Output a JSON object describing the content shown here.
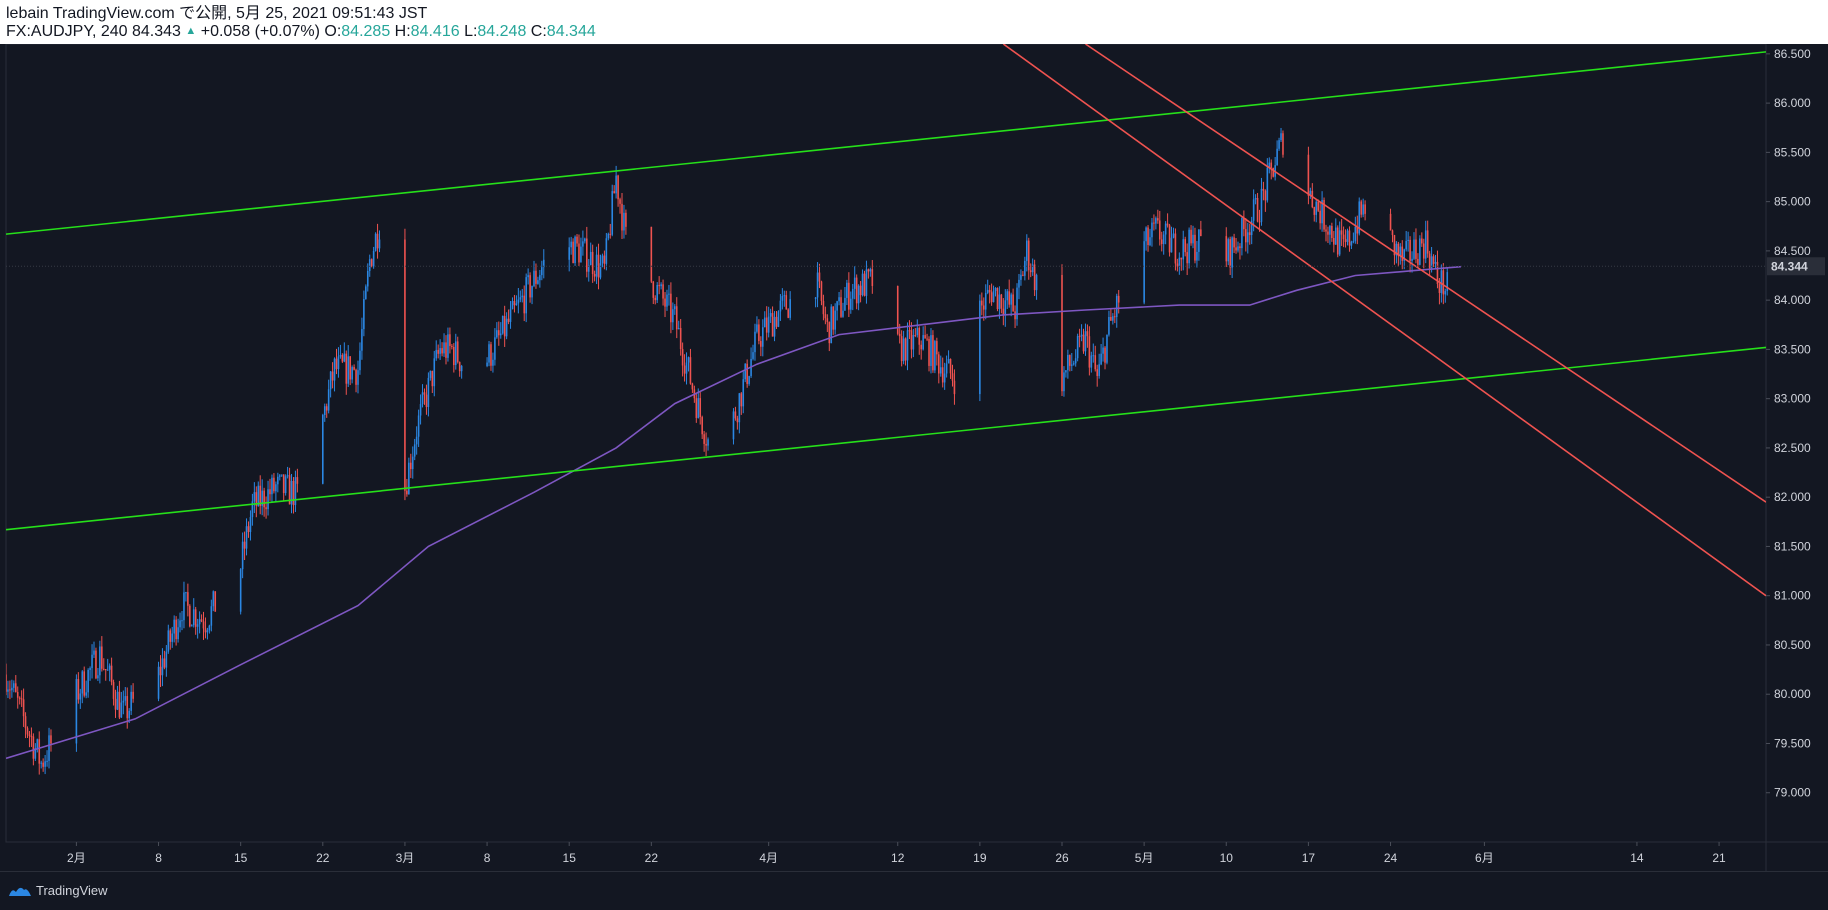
{
  "header": {
    "publisher_line": "lebain TradingView.com で公開, 5月 25, 2021 09:51:43 JST",
    "symbol": "FX:AUDJPY, 240",
    "last": "84.343",
    "change": "+0.058 (+0.07%)",
    "open_label": "O:",
    "open": "84.285",
    "high_label": "H:",
    "high": "84.416",
    "low_label": "L:",
    "low": "84.248",
    "close_label": "C:",
    "close": "84.344"
  },
  "footer": {
    "brand": "TradingView"
  },
  "colors": {
    "background": "#131722",
    "up_candle": "#2b87e3",
    "down_candle": "#ef5350",
    "ma_line": "#7e57c2",
    "channel_green": "#26e01a",
    "channel_red": "#ef5350",
    "price_badge": "#2a2e39"
  },
  "chart_data": {
    "type": "candlestick",
    "symbol": "FX:AUDJPY",
    "interval": "240",
    "ylim": [
      78.5,
      86.6
    ],
    "y_ticks": [
      "79.000",
      "79.500",
      "80.000",
      "80.500",
      "81.000",
      "81.500",
      "82.000",
      "82.500",
      "83.000",
      "83.500",
      "84.000",
      "84.500",
      "85.000",
      "85.500",
      "86.000",
      "86.500"
    ],
    "x_ticks": [
      "2月",
      "8",
      "15",
      "22",
      "3月",
      "8",
      "15",
      "22",
      "4月",
      "12",
      "19",
      "26",
      "5月",
      "10",
      "17",
      "24",
      "6月",
      "14",
      "21"
    ],
    "current_price": "84.344",
    "close_path": [
      {
        "date": "2021-01-26",
        "price": 80.2
      },
      {
        "date": "2021-01-29",
        "price": 79.3
      },
      {
        "date": "2021-02-01",
        "price": 80.0
      },
      {
        "date": "2021-02-03",
        "price": 80.4
      },
      {
        "date": "2021-02-05",
        "price": 79.8
      },
      {
        "date": "2021-02-08",
        "price": 80.2
      },
      {
        "date": "2021-02-10",
        "price": 80.9
      },
      {
        "date": "2021-02-12",
        "price": 80.75
      },
      {
        "date": "2021-02-15",
        "price": 81.3
      },
      {
        "date": "2021-02-16",
        "price": 81.9
      },
      {
        "date": "2021-02-18",
        "price": 82.1
      },
      {
        "date": "2021-02-21",
        "price": 82.0
      },
      {
        "date": "2021-02-22",
        "price": 82.8
      },
      {
        "date": "2021-02-23",
        "price": 83.3
      },
      {
        "date": "2021-02-25",
        "price": 83.3
      },
      {
        "date": "2021-02-26",
        "price": 84.4
      },
      {
        "date": "2021-02-27",
        "price": 84.85
      },
      {
        "date": "2021-02-28",
        "price": 83.2
      },
      {
        "date": "2021-03-01",
        "price": 82.1
      },
      {
        "date": "2021-03-02",
        "price": 82.7
      },
      {
        "date": "2021-03-04",
        "price": 83.5
      },
      {
        "date": "2021-03-05",
        "price": 83.5
      },
      {
        "date": "2021-03-07",
        "price": 83.2
      },
      {
        "date": "2021-03-09",
        "price": 83.6
      },
      {
        "date": "2021-03-11",
        "price": 84.0
      },
      {
        "date": "2021-03-14",
        "price": 84.6
      },
      {
        "date": "2021-03-16",
        "price": 84.5
      },
      {
        "date": "2021-03-18",
        "price": 84.3
      },
      {
        "date": "2021-03-19",
        "price": 85.25
      },
      {
        "date": "2021-03-20",
        "price": 84.5
      },
      {
        "date": "2021-03-22",
        "price": 84.2
      },
      {
        "date": "2021-03-24",
        "price": 83.8
      },
      {
        "date": "2021-03-26",
        "price": 82.9
      },
      {
        "date": "2021-03-27",
        "price": 82.5
      },
      {
        "date": "2021-03-29",
        "price": 82.8
      },
      {
        "date": "2021-03-31",
        "price": 83.6
      },
      {
        "date": "2021-04-02",
        "price": 83.9
      },
      {
        "date": "2021-04-05",
        "price": 84.2
      },
      {
        "date": "2021-04-06",
        "price": 83.7
      },
      {
        "date": "2021-04-08",
        "price": 84.1
      },
      {
        "date": "2021-04-10",
        "price": 84.2
      },
      {
        "date": "2021-04-12",
        "price": 83.5
      },
      {
        "date": "2021-04-14",
        "price": 83.6
      },
      {
        "date": "2021-04-16",
        "price": 83.3
      },
      {
        "date": "2021-04-18",
        "price": 83.1
      },
      {
        "date": "2021-04-19",
        "price": 83.9
      },
      {
        "date": "2021-04-20",
        "price": 84.1
      },
      {
        "date": "2021-04-22",
        "price": 83.9
      },
      {
        "date": "2021-04-23",
        "price": 84.5
      },
      {
        "date": "2021-04-25",
        "price": 83.7
      },
      {
        "date": "2021-04-26",
        "price": 83.2
      },
      {
        "date": "2021-04-28",
        "price": 83.6
      },
      {
        "date": "2021-04-29",
        "price": 83.2
      },
      {
        "date": "2021-04-30",
        "price": 83.7
      },
      {
        "date": "2021-05-02",
        "price": 84.4
      },
      {
        "date": "2021-05-04",
        "price": 84.7
      },
      {
        "date": "2021-05-06",
        "price": 84.5
      },
      {
        "date": "2021-05-08",
        "price": 84.6
      },
      {
        "date": "2021-05-09",
        "price": 84.3
      },
      {
        "date": "2021-05-11",
        "price": 84.6
      },
      {
        "date": "2021-05-13",
        "price": 85.0
      },
      {
        "date": "2021-05-15",
        "price": 85.7
      },
      {
        "date": "2021-05-16",
        "price": 85.3
      },
      {
        "date": "2021-05-18",
        "price": 84.9
      },
      {
        "date": "2021-05-20",
        "price": 84.5
      },
      {
        "date": "2021-05-22",
        "price": 85.0
      },
      {
        "date": "2021-05-23",
        "price": 84.8
      },
      {
        "date": "2021-05-25",
        "price": 84.4
      },
      {
        "date": "2021-05-27",
        "price": 84.6
      },
      {
        "date": "2021-05-28",
        "price": 84.2
      },
      {
        "date": "2021-05-29",
        "price": 84.1
      },
      {
        "date": "2021-05-30",
        "price": 84.34
      }
    ],
    "moving_average": [
      {
        "date": "2021-01-26",
        "price": 79.35
      },
      {
        "date": "2021-02-06",
        "price": 79.75
      },
      {
        "date": "2021-02-15",
        "price": 80.3
      },
      {
        "date": "2021-02-25",
        "price": 80.9
      },
      {
        "date": "2021-03-03",
        "price": 81.5
      },
      {
        "date": "2021-03-12",
        "price": 82.05
      },
      {
        "date": "2021-03-19",
        "price": 82.5
      },
      {
        "date": "2021-03-24",
        "price": 82.95
      },
      {
        "date": "2021-03-31",
        "price": 83.35
      },
      {
        "date": "2021-04-07",
        "price": 83.65
      },
      {
        "date": "2021-04-14",
        "price": 83.75
      },
      {
        "date": "2021-04-21",
        "price": 83.85
      },
      {
        "date": "2021-04-28",
        "price": 83.9
      },
      {
        "date": "2021-05-06",
        "price": 83.95
      },
      {
        "date": "2021-05-12",
        "price": 83.95
      },
      {
        "date": "2021-05-16",
        "price": 84.1
      },
      {
        "date": "2021-05-21",
        "price": 84.25
      },
      {
        "date": "2021-05-26",
        "price": 84.3
      },
      {
        "date": "2021-05-30",
        "price": 84.34
      }
    ],
    "trendlines": [
      {
        "name": "green-upper",
        "color": "#26e01a",
        "from": {
          "date": "2021-01-26",
          "price": 84.67
        },
        "to": {
          "date": "2021-06-25",
          "price": 86.52
        }
      },
      {
        "name": "green-lower",
        "color": "#26e01a",
        "from": {
          "date": "2021-01-26",
          "price": 81.67
        },
        "to": {
          "date": "2021-06-25",
          "price": 83.52
        }
      },
      {
        "name": "red-lower",
        "color": "#ef5350",
        "from": {
          "date": "2021-04-21",
          "price": 86.6
        },
        "to": {
          "date": "2021-06-25",
          "price": 81.0
        }
      },
      {
        "name": "red-upper",
        "color": "#ef5350",
        "from": {
          "date": "2021-04-28",
          "price": 86.6
        },
        "to": {
          "date": "2021-06-25",
          "price": 81.95
        }
      }
    ]
  }
}
